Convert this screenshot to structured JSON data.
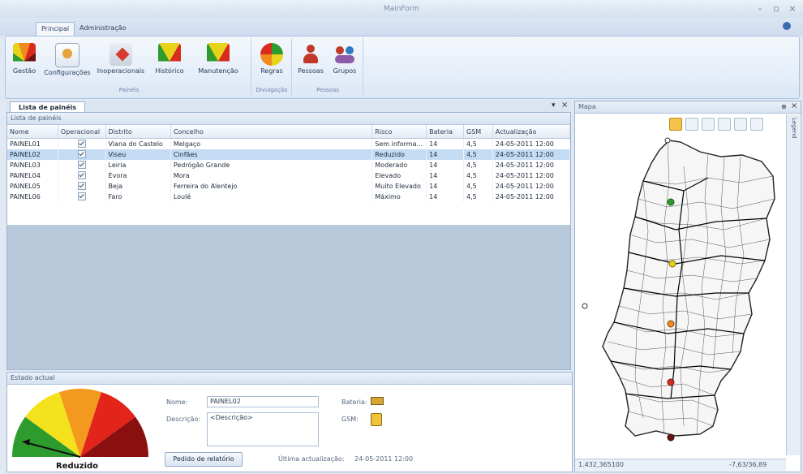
{
  "window": {
    "title": "MainForm"
  },
  "ribbon": {
    "tabs": [
      "Principal",
      "Administração"
    ],
    "groups": [
      {
        "label": "Painéis",
        "buttons": [
          "Gestão",
          "Configurações",
          "Inoperacionais",
          "Histórico",
          "Manutenção"
        ]
      },
      {
        "label": "Divulgação",
        "buttons": [
          "Regras"
        ]
      },
      {
        "label": "Pessoas",
        "buttons": [
          "Pessoas",
          "Grupos"
        ]
      }
    ]
  },
  "list_panel": {
    "tab_label": "Lista de painéis",
    "caption": "Lista de painéis",
    "columns": [
      "Nome",
      "Operacional",
      "Distrito",
      "Concelho",
      "Risco",
      "Bateria",
      "GSM",
      "Actualização"
    ],
    "rows": [
      [
        "PAINEL01",
        "Viana do Castelo",
        "Melgaço",
        "Sem informa...",
        "14",
        "4,5",
        "24-05-2011 12:00"
      ],
      [
        "PAINEL02",
        "Viseu",
        "Cinfães",
        "Reduzido",
        "14",
        "4,5",
        "24-05-2011 12:00"
      ],
      [
        "PAINEL03",
        "Leiria",
        "Pedrógão Grande",
        "Moderado",
        "14",
        "4,5",
        "24-05-2011 12:00"
      ],
      [
        "PAINEL04",
        "Évora",
        "Mora",
        "Elevado",
        "14",
        "4,5",
        "24-05-2011 12:00"
      ],
      [
        "PAINEL05",
        "Beja",
        "Ferreira do Alentejo",
        "Muito Elevado",
        "14",
        "4,5",
        "24-05-2011 12:00"
      ],
      [
        "PAINEL06",
        "Faro",
        "Loulé",
        "Máximo",
        "14",
        "4,5",
        "24-05-2011 12:00"
      ]
    ],
    "selected_row": 1
  },
  "estado": {
    "caption": "Estado actual",
    "gauge_label": "Reduzido",
    "nome_label": "Nome:",
    "nome_value": "PAINEL02",
    "descricao_label": "Descrição:",
    "descricao_value": "<Descrição>",
    "bateria_label": "Bateria:",
    "gsm_label": "GSM:",
    "report_button": "Pedido de relatório",
    "last_update_label": "Última actualização:",
    "last_update_value": "24-05-2011 12:00"
  },
  "map_panel": {
    "caption": "Mapa",
    "legend_tab": "Legend",
    "coord_left": "1.432,365100",
    "coord_right": "-7,63/36,89",
    "marker_colors": [
      "#2e9b2e",
      "#e8d21a",
      "#f08a1e",
      "#d92a1e",
      "#6b1414"
    ]
  },
  "colors": {
    "selection": "#c4dbf4",
    "accent": "#2f5d9b"
  }
}
